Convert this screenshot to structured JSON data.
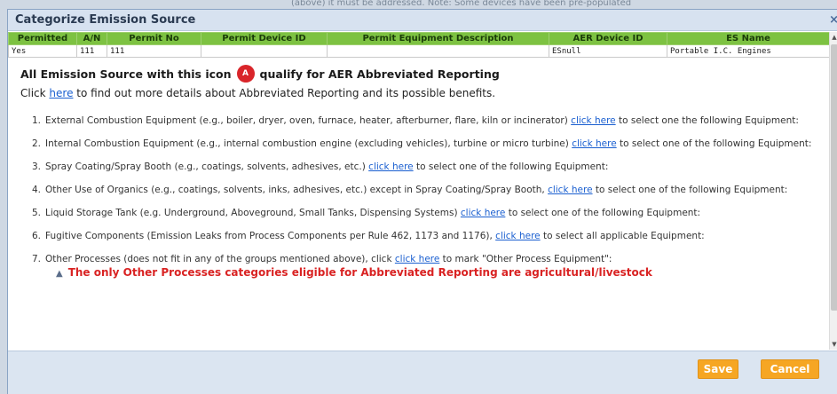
{
  "background": {
    "text": "(above) it must be addressed. Note: Some devices have been pre-populated"
  },
  "dialog": {
    "title": "Categorize Emission Source",
    "close_glyph": "×"
  },
  "table": {
    "headers": [
      "Permitted",
      "A/N",
      "Permit No",
      "Permit Device ID",
      "Permit Equipment Description",
      "AER Device ID",
      "ES Name"
    ],
    "rows": [
      [
        "Yes",
        "111",
        "111",
        "",
        "",
        "ESnull",
        "Portable I.C. Engines"
      ]
    ]
  },
  "notice": {
    "prefix": "All Emission Source with this icon",
    "badge": "A",
    "suffix": "qualify for AER Abbreviated Reporting",
    "click_prefix": "Click ",
    "click_link": "here",
    "click_suffix": " to find out more details about Abbreviated Reporting and its possible benefits."
  },
  "items": [
    {
      "num": "1.",
      "before": "External Combustion Equipment (e.g., boiler, dryer, oven, furnace, heater, afterburner, flare, kiln or incinerator) ",
      "link": "click here",
      "after": " to select one the following Equipment:"
    },
    {
      "num": "2.",
      "before": "Internal Combustion Equipment (e.g., internal combustion engine (excluding vehicles), turbine or micro turbine) ",
      "link": "click here",
      "after": " to select one of the following Equipment:"
    },
    {
      "num": "3.",
      "before": "Spray Coating/Spray Booth (e.g., coatings, solvents, adhesives, etc.) ",
      "link": "click here",
      "after": " to select one of the following Equipment:"
    },
    {
      "num": "4.",
      "before": "Other Use of Organics (e.g., coatings, solvents, inks, adhesives, etc.) except in Spray Coating/Spray Booth, ",
      "link": "click here",
      "after": " to select one of the following Equipment:"
    },
    {
      "num": "5.",
      "before": "Liquid Storage Tank (e.g. Underground, Aboveground, Small Tanks, Dispensing Systems) ",
      "link": "click here",
      "after": " to select one of the following Equipment:"
    },
    {
      "num": "6.",
      "before": "Fugitive Components (Emission Leaks from Process Components per Rule 462, 1173 and 1176), ",
      "link": "click here",
      "after": " to select all applicable Equipment:"
    },
    {
      "num": "7.",
      "before": "Other Processes (does not fit in any of the groups mentioned above), click ",
      "link": "click here",
      "after": " to mark \"Other Process Equipment\":"
    }
  ],
  "warning": "The only Other Processes categories eligible for Abbreviated Reporting are agricultural/livestock",
  "buttons": {
    "save": "Save",
    "cancel": "Cancel"
  },
  "colors": {
    "accent_orange": "#f6a623",
    "header_green": "#7dc242",
    "badge_red": "#d9252a",
    "warning_red": "#d92323",
    "link_blue": "#1a5fd0"
  },
  "icons": {
    "close": "close-icon",
    "badge": "abbreviated-reporting-badge-icon",
    "warning": "warning-triangle-icon"
  }
}
